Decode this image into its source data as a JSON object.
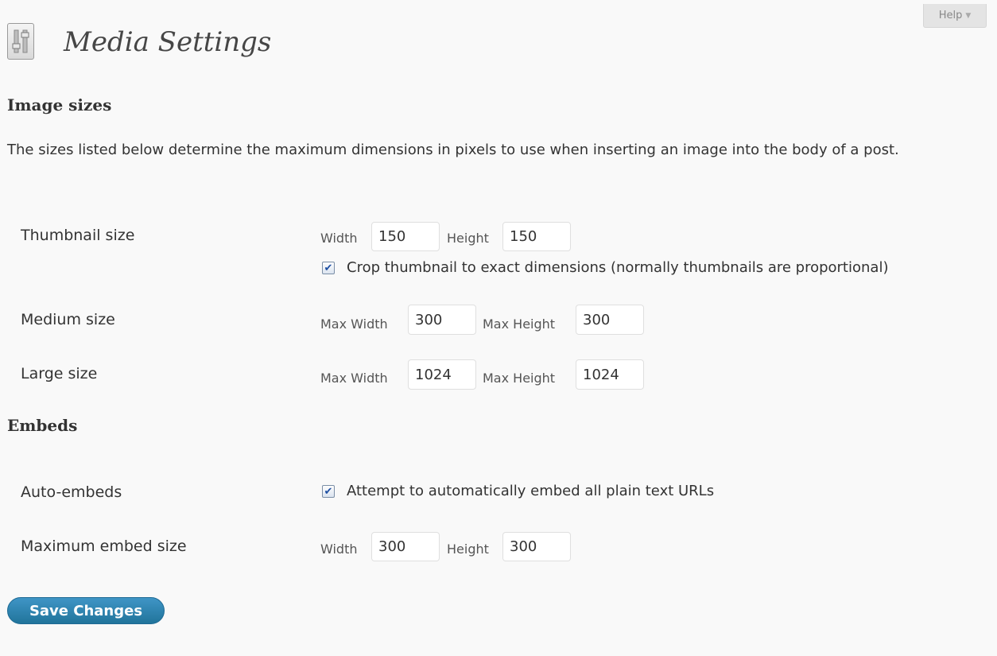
{
  "help": {
    "label": "Help",
    "arrow_icon": "triangle-down-icon"
  },
  "header": {
    "title": "Media Settings",
    "icon": "settings-sliders-icon"
  },
  "image_sizes": {
    "heading": "Image sizes",
    "description": "The sizes listed below determine the maximum dimensions in pixels to use when inserting an image into the body of a post.",
    "thumbnail": {
      "label": "Thumbnail size",
      "width_label": "Width",
      "width_value": "150",
      "height_label": "Height",
      "height_value": "150",
      "crop_checked": true,
      "crop_label": "Crop thumbnail to exact dimensions (normally thumbnails are proportional)"
    },
    "medium": {
      "label": "Medium size",
      "width_label": "Max Width",
      "width_value": "300",
      "height_label": "Max Height",
      "height_value": "300"
    },
    "large": {
      "label": "Large size",
      "width_label": "Max Width",
      "width_value": "1024",
      "height_label": "Max Height",
      "height_value": "1024"
    }
  },
  "embeds": {
    "heading": "Embeds",
    "auto": {
      "label": "Auto-embeds",
      "checked": true,
      "check_label": "Attempt to automatically embed all plain text URLs"
    },
    "max_size": {
      "label": "Maximum embed size",
      "width_label": "Width",
      "width_value": "300",
      "height_label": "Height",
      "height_value": "300"
    }
  },
  "footer": {
    "save_label": "Save Changes"
  },
  "colors": {
    "primary_button": "#21759b",
    "checkbox_check": "#1d4ea2",
    "background": "#f9f9f9"
  }
}
